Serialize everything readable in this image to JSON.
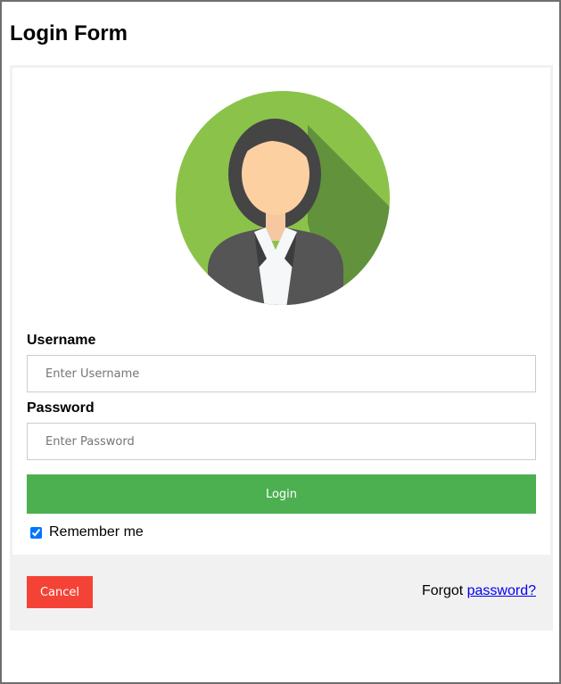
{
  "page": {
    "title": "Login Form"
  },
  "colors": {
    "login_button": "#4caf50",
    "cancel_button": "#f44336",
    "footer_bg": "#f1f1f1",
    "link": "#0000ee",
    "avatar_bg": "#8bc34a"
  },
  "avatar": {
    "icon": "female-user-avatar-icon"
  },
  "form": {
    "username_label": "Username",
    "username_placeholder": "Enter Username",
    "username_value": "",
    "password_label": "Password",
    "password_placeholder": "Enter Password",
    "password_value": "",
    "login_label": "Login",
    "remember_label": "Remember me",
    "remember_checked": true
  },
  "footer": {
    "cancel_label": "Cancel",
    "forgot_prefix": "Forgot ",
    "forgot_link": "password?"
  }
}
